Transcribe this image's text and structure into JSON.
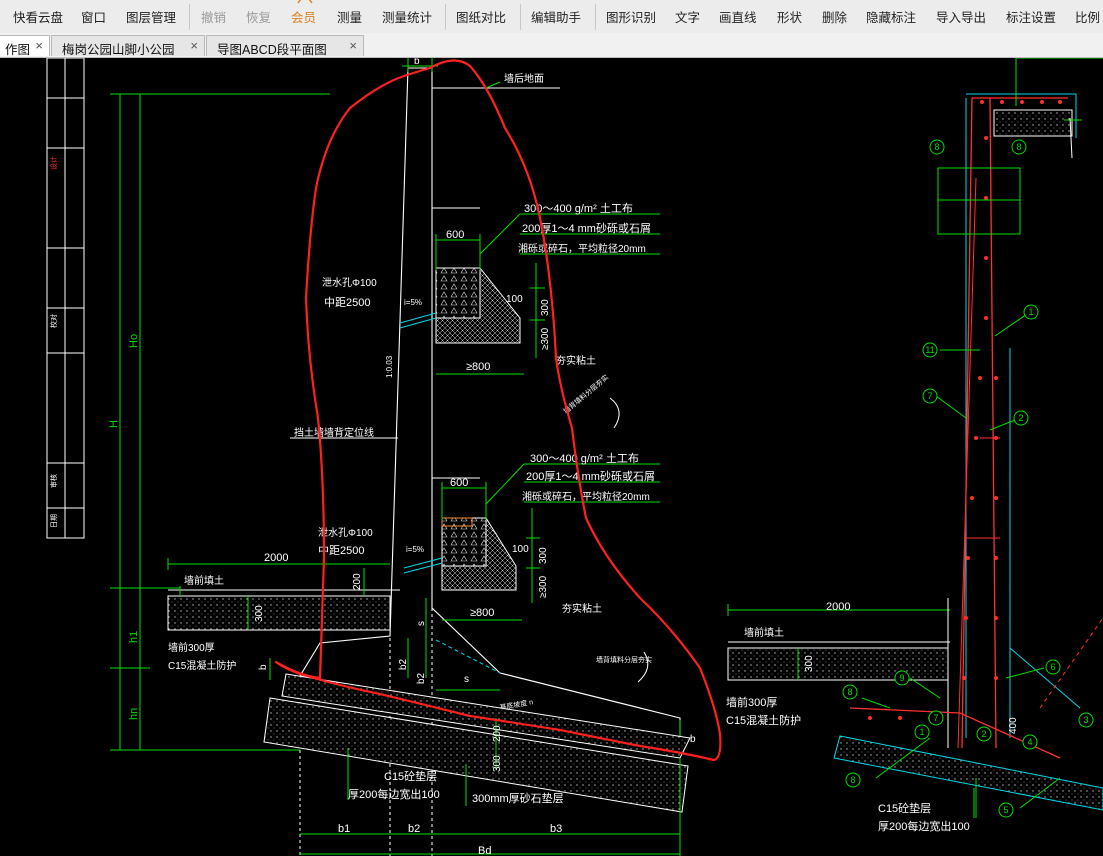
{
  "toolbar": {
    "items": [
      {
        "label": "快看云盘"
      },
      {
        "label": "窗口"
      },
      {
        "label": "图层管理"
      },
      {
        "label": "撤销"
      },
      {
        "label": "恢复"
      },
      {
        "label": "会员"
      },
      {
        "label": "测量"
      },
      {
        "label": "测量统计"
      },
      {
        "label": "图纸对比"
      },
      {
        "label": "编辑助手"
      },
      {
        "label": "图形识别"
      },
      {
        "label": "文字"
      },
      {
        "label": "画直线"
      },
      {
        "label": "形状"
      },
      {
        "label": "删除"
      },
      {
        "label": "隐藏标注"
      },
      {
        "label": "导入导出"
      },
      {
        "label": "标注设置"
      },
      {
        "label": "比例"
      }
    ]
  },
  "tabs": [
    {
      "label": "作图",
      "close": "×"
    },
    {
      "label": "梅岗公园山脚小公园",
      "close": "×"
    },
    {
      "label": "导图ABCD段平面图",
      "close": "×"
    }
  ],
  "colors": {
    "canvas": "#000000",
    "outline": "#ffffff",
    "dimension": "#00e000",
    "cyan": "#00d8e8",
    "markup": "#ff2020",
    "rebar": "#ff3030"
  },
  "drawing": {
    "labels": {
      "b_top": "b",
      "wall_back_ground": "墙后地面",
      "geotextile_1": "300～400 g/m² 土工布",
      "sand_gravel_1": "200厚1～4 mm砂砾或石屑",
      "crushed_stone_1": "湘砾或碎石，平均粒径20mm",
      "dim_600_1": "600",
      "drain_hole_1": "泄水孔Φ100",
      "spacing_1": "中距2500",
      "slope_1": "i=5%",
      "dim_100_1": "100",
      "dim_300_1": "300",
      "dim_300_2": "≥300",
      "dim_800_1": "≥800",
      "clay_1": "夯实粘土",
      "ratio": "1:0.03",
      "wall_position_line": "挡土墙墙背定位线",
      "fill_note_1": "墙背填料分层夯实",
      "geotextile_2": "300～400 g/m² 土工布",
      "sand_gravel_2": "200厚1～4 mm砂砾或石屑",
      "crushed_stone_2": "湘砾或碎石，平均粒径20mm",
      "dim_600_2": "600",
      "drain_hole_2": "泄水孔Φ100",
      "spacing_2": "中距2500",
      "slope_2": "i=5%",
      "dim_100_2": "100",
      "dim_300_3": "300",
      "dim_300_4": "≥300",
      "dim_800_2": "≥800",
      "clay_2": "夯实粘土",
      "dim_2000_left": "2000",
      "front_fill_left": "墙前填土",
      "dim_300_front": "300",
      "dim_200": "200",
      "front_concrete_1": "墙前300厚",
      "front_concrete_2": "C15混凝土防护",
      "fill_note_2": "墙背填料分层夯实",
      "dim_s": "s",
      "dim_b2": "b2",
      "dim_b": "b",
      "dim_b_right": "b",
      "base_note": "基底坡度 n",
      "dim_200_base": "200",
      "dim_300_base": "300",
      "cushion_1": "C15砼垫层",
      "cushion_2": "厚200每边宽出100",
      "sand_cushion": "300mm厚砂石垫层",
      "dim_Ho": "Ho",
      "dim_H": "H",
      "dim_h1": "h1",
      "dim_hn": "hn",
      "dim_b1": "b1",
      "dim_b2_bottom": "b2",
      "dim_b3": "b3",
      "dim_Bd": "Bd",
      "dim_2000_right": "2000",
      "front_fill_right": "墙前填土",
      "dim_300_right": "300",
      "front_concrete_r1": "墙前300厚",
      "front_concrete_r2": "C15混凝土防护",
      "cushion_r1": "C15砼垫层",
      "cushion_r2": "厚200每边宽出100",
      "dim_400": "400",
      "title_block_red": "设计",
      "title_block_1": "校对",
      "title_block_2": "审核",
      "title_block_3": "日期"
    },
    "markers": [
      "8",
      "8",
      "1",
      "11",
      "7",
      "2",
      "6",
      "9",
      "8",
      "7",
      "1",
      "2",
      "4",
      "8",
      "5",
      "3"
    ]
  }
}
